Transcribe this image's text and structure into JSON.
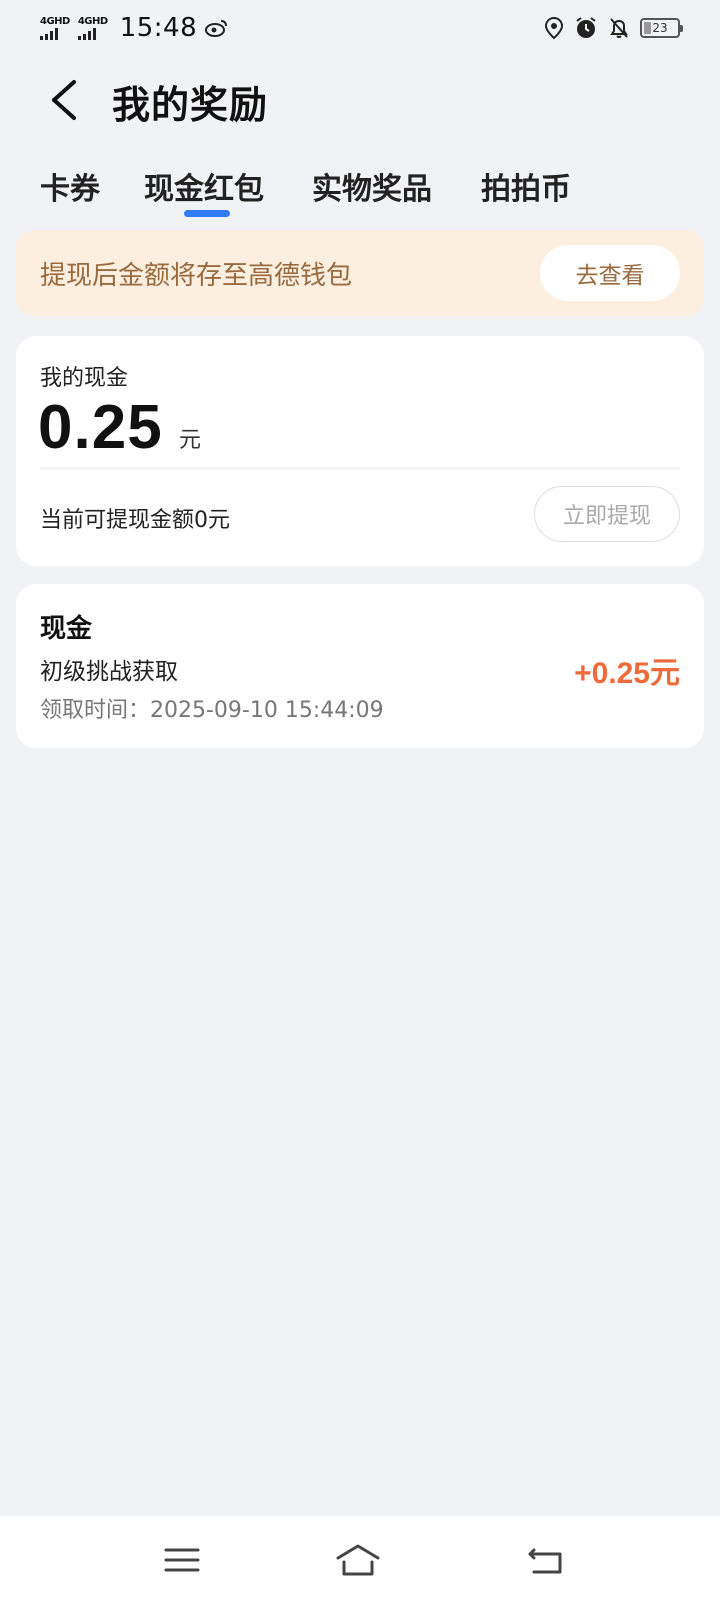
{
  "status_bar": {
    "signal1": "4GHD",
    "signal2": "4GHD",
    "time": "15:48",
    "battery": "23"
  },
  "header": {
    "title": "我的奖励"
  },
  "tabs": [
    {
      "label": "卡券"
    },
    {
      "label": "现金红包",
      "active": true
    },
    {
      "label": "实物奖品"
    },
    {
      "label": "拍拍币"
    }
  ],
  "banner": {
    "text": "提现后金额将存至高德钱包",
    "button": "去查看"
  },
  "cash_card": {
    "label": "我的现金",
    "amount": "0.25",
    "unit": "元",
    "available_text": "当前可提现金额0元",
    "withdraw_button": "立即提现"
  },
  "records": [
    {
      "title": "现金",
      "description": "初级挑战获取",
      "time": "领取时间：2025-09-10 15:44:09",
      "amount": "+0.25元"
    }
  ],
  "colors": {
    "accent": "#2f7cf6",
    "amount_positive": "#ef6a3a",
    "banner_bg": "#fcefe0",
    "banner_text": "#9a6a3f",
    "page_bg": "#f1f2f6"
  },
  "icons": [
    "weibo-icon",
    "location-icon",
    "alarm-icon",
    "bell-off-icon",
    "back-arrow-icon",
    "menu-icon",
    "home-icon",
    "return-icon"
  ]
}
